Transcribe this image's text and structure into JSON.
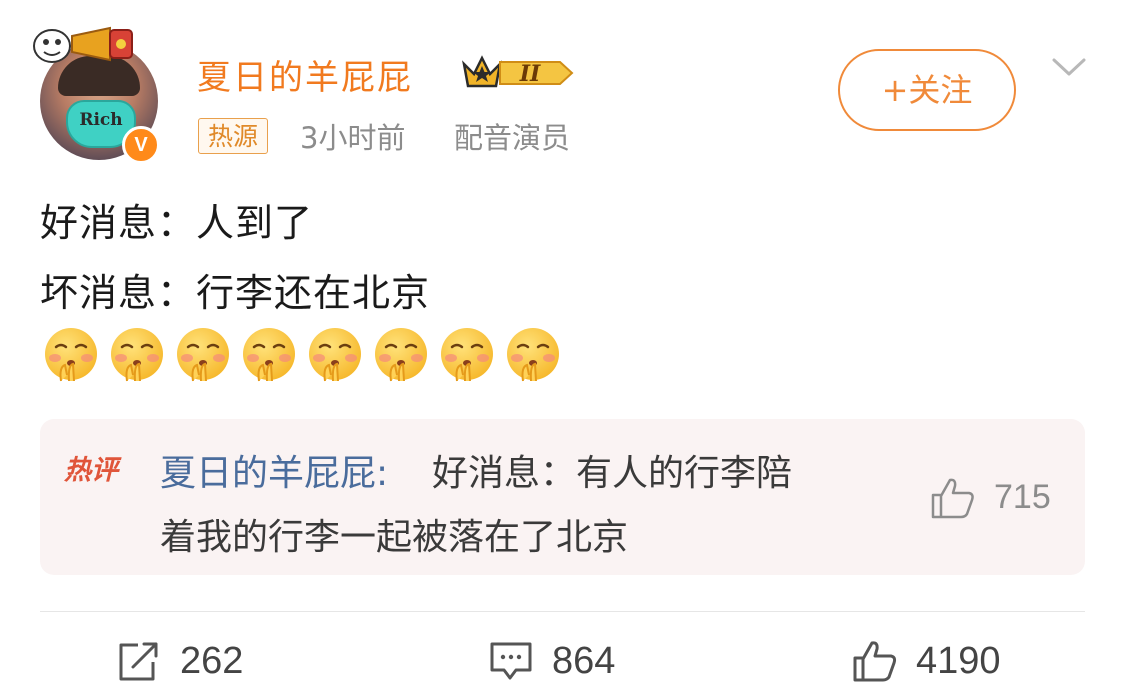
{
  "post": {
    "author": {
      "name": "夏日的羊屁屁",
      "level_badge": "II",
      "verified_badge": "V",
      "avatar_mask_text": "Rich"
    },
    "meta": {
      "source_tag": "热源",
      "time": "3小时前",
      "identity": "配音演员"
    },
    "follow_label": "+关注",
    "content": {
      "line1": "好消息：人到了",
      "line2": "坏消息：行李还在北京",
      "emoji_count": 8,
      "emoji_name": "shushing-face"
    },
    "hot_comment": {
      "logo": "热评",
      "author": "夏日的羊屁屁:",
      "text_line1": "好消息：有人的行李陪",
      "text_line2": "着我的行李一起被落在了北京",
      "likes": "715"
    },
    "actions": {
      "repost_count": "262",
      "comment_count": "864",
      "like_count": "4190"
    }
  },
  "colors": {
    "brand_orange": "#f08a3a",
    "name_orange": "#f17a1f",
    "comment_name_blue": "#4a6c9c",
    "hot_comment_bg": "#faf3f3"
  }
}
